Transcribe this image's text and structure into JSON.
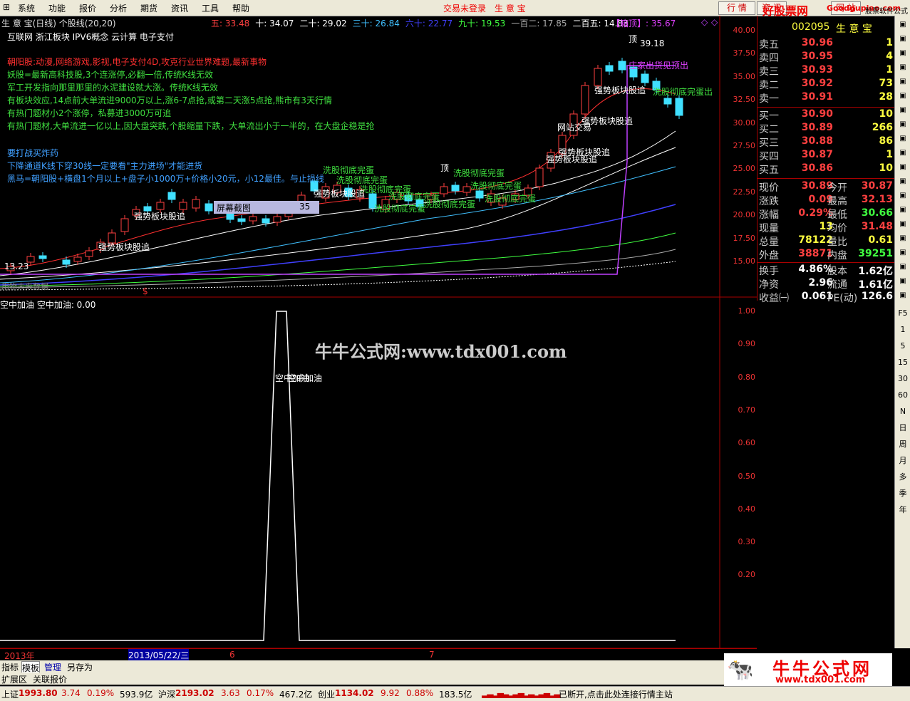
{
  "menu": {
    "items": [
      "系统",
      "功能",
      "报价",
      "分析",
      "期货",
      "资讯",
      "工具",
      "帮助"
    ],
    "center_status": "交易未登录",
    "center_name": "生 意 宝",
    "btn_quote": "行 情",
    "btn_info": "资 讯",
    "btn_web": "网 站",
    "brand": "好股票网",
    "brand_url": "Goodgupiao.com",
    "brand_sub": "股票软件公式"
  },
  "chart_header": {
    "title": "生 意 宝(日线) 个股线(20,20)",
    "ma": [
      {
        "label": "五: 33.48",
        "color": "#ff4040"
      },
      {
        "label": "十: 34.07",
        "color": "#ffffff"
      },
      {
        "label": "二十: 29.02",
        "color": "#ffffff"
      },
      {
        "label": "三十: 26.84",
        "color": "#40c0ff"
      },
      {
        "label": "六十: 22.77",
        "color": "#4040ff"
      },
      {
        "label": "九十: 19.53",
        "color": "#40ff40"
      },
      {
        "label": "一百二: 17.85",
        "color": "#aaaaaa"
      },
      {
        "label": "二百五: 14.83",
        "color": "#ffffff"
      }
    ],
    "box_label": "【箱顶】: 35.67"
  },
  "concepts": "互联网 浙江板块 IPV6概念 云计算 电子支付",
  "notes": [
    {
      "text": "朝阳股:动漫,网络游戏,影视,电子支付4D,攻克行业世界难题,最新事物",
      "color": "#ff3030"
    },
    {
      "text": "妖股=最新高科技股,3个连涨停,必翻一倍,传统K线无效",
      "color": "#40e040"
    },
    {
      "text": "军工开发指向那里那里的水泥建设就大涨。传统K线无效",
      "color": "#40e040"
    },
    {
      "text": "有板块效应,14点前大单流进9000万以上,涨6-7点抢,或第二天涨5点抢,熊市有3天行情",
      "color": "#40e040"
    },
    {
      "text": "有热门题材小2个涨停，私募进3000万可追",
      "color": "#40e040"
    },
    {
      "text": "有热门题材,大单流进一亿以上,因大盘突跌,个股缩量下跌，大单流出小于一半的，在大盘企稳是抢",
      "color": "#40e040"
    },
    {
      "text": "要打战买炸药",
      "color": "#40a0ff"
    },
    {
      "text": "下降通道K线下穿30线一定要看\"主力进场\"才能进货",
      "color": "#40a0ff"
    },
    {
      "text": "黑马=朝阳股+横盘1个月以上+盘子小1000万+价格小20元，小12最佳。与止损线",
      "color": "#40a0ff"
    }
  ],
  "chart_labels": {
    "strong1": "强势板块股追",
    "strong2": "强势板块股追",
    "strong3": "强势板块股追",
    "strong4": "强势板块股追",
    "strong5": "强势板块股追",
    "wash": "洗股彻底完蛋",
    "top": "顶",
    "top_price": "39.18",
    "website": "网站交易",
    "dealer_out": "庄家出货见顶出",
    "wash_out": "洗股彻底完蛋出",
    "low_price": "13.23",
    "screenshot": "屏幕截图",
    "screenshot_num": "35",
    "dollar": "$",
    "future_data": "用物未来数据"
  },
  "price_axis": [
    "40.00",
    "37.50",
    "35.00",
    "32.50",
    "30.00",
    "27.50",
    "25.00",
    "22.50",
    "20.00",
    "17.50",
    "15.00"
  ],
  "chart_data": [
    {
      "type": "line",
      "title": "空中加油 空中加油: 0.00",
      "series": [
        {
          "name": "空中加油",
          "values": [
            0,
            0,
            1,
            1,
            0,
            0
          ]
        }
      ],
      "ylim": [
        0,
        1
      ],
      "y_ticks": [
        "1.00",
        "0.90",
        "0.80",
        "0.70",
        "0.60",
        "0.50",
        "0.40",
        "0.30",
        "0.20"
      ],
      "peak_label": "空中加油"
    }
  ],
  "watermark": "牛牛公式网:www.tdx001.com",
  "date_axis": {
    "year": "2013年",
    "cursor": "2013/05/22/三",
    "m6": "6",
    "m7": "7"
  },
  "quote": {
    "code": "002095",
    "name": "生 意 宝",
    "sells": [
      {
        "label": "卖五",
        "price": "30.96",
        "vol": "1"
      },
      {
        "label": "卖四",
        "price": "30.95",
        "vol": "4"
      },
      {
        "label": "卖三",
        "price": "30.93",
        "vol": "1"
      },
      {
        "label": "卖二",
        "price": "30.92",
        "vol": "73"
      },
      {
        "label": "卖一",
        "price": "30.91",
        "vol": "28"
      }
    ],
    "buys": [
      {
        "label": "买一",
        "price": "30.90",
        "vol": "10"
      },
      {
        "label": "买二",
        "price": "30.89",
        "vol": "266"
      },
      {
        "label": "买三",
        "price": "30.88",
        "vol": "86"
      },
      {
        "label": "买四",
        "price": "30.87",
        "vol": "1"
      },
      {
        "label": "买五",
        "price": "30.86",
        "vol": "10"
      }
    ],
    "stats": [
      {
        "l1": "现价",
        "v1": "30.89",
        "c1": "#ff4040",
        "l2": "今开",
        "v2": "30.87",
        "c2": "#ff4040"
      },
      {
        "l1": "涨跌",
        "v1": "0.09",
        "c1": "#ff4040",
        "l2": "最高",
        "v2": "32.13",
        "c2": "#ff4040"
      },
      {
        "l1": "涨幅",
        "v1": "0.29%",
        "c1": "#ff4040",
        "l2": "最低",
        "v2": "30.66",
        "c2": "#40ff40"
      },
      {
        "l1": "现量",
        "v1": "13",
        "c1": "#ffff40",
        "l2": "均价",
        "v2": "31.48",
        "c2": "#ff4040"
      },
      {
        "l1": "总量",
        "v1": "78122",
        "c1": "#ffff40",
        "l2": "量比",
        "v2": "0.61",
        "c2": "#ffff40"
      },
      {
        "l1": "外盘",
        "v1": "38871",
        "c1": "#ff4040",
        "l2": "内盘",
        "v2": "39251",
        "c2": "#40ff40"
      },
      {
        "l1": "换手",
        "v1": "4.86%",
        "c1": "#ffffff",
        "l2": "股本",
        "v2": "1.62亿",
        "c2": "#ffffff"
      },
      {
        "l1": "净资",
        "v1": "2.96",
        "c1": "#ffffff",
        "l2": "流通",
        "v2": "1.61亿",
        "c2": "#ffffff"
      },
      {
        "l1": "收益㈠",
        "v1": "0.061",
        "c1": "#ffffff",
        "l2": "PE(动)",
        "v2": "126.6",
        "c2": "#ffffff"
      }
    ]
  },
  "toolbar_right": [
    "F5",
    "1",
    "5",
    "15",
    "30",
    "60",
    "N",
    "日",
    "周",
    "月",
    "多",
    "季",
    "年"
  ],
  "tabs1": [
    "指标",
    "模板",
    "管理",
    "另存为"
  ],
  "tabs2": [
    "扩展区",
    "关联报价"
  ],
  "status": {
    "sh_label": "上证",
    "sh_val": "1993.80",
    "sh_chg": "3.74",
    "sh_pct": "0.19%",
    "sh_amt": "593.9亿",
    "hs_label": "沪深",
    "hs_val": "2193.02",
    "hs_chg": "3.63",
    "hs_pct": "0.17%",
    "hs_amt": "467.2亿",
    "cy_label": "创业",
    "cy_val": "1134.02",
    "cy_chg": "9.92",
    "cy_pct": "0.88%",
    "cy_amt": "183.5亿",
    "msg": "已断开,点击此处连接行情主站"
  },
  "logo": {
    "title": "牛牛公式网",
    "url": "www.tdx001.com"
  },
  "colors": {
    "up": "#ff4040",
    "down": "#40ff40",
    "bg": "#000000",
    "frame": "#aa0000"
  }
}
